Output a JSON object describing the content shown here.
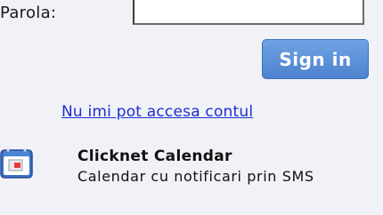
{
  "login": {
    "password_label": "Parola:",
    "password_value": "",
    "signin_label": "Sign in",
    "recover_link": "Nu imi pot accesa contul"
  },
  "promo": {
    "icon": "calendar-icon",
    "title": "Clicknet Calendar",
    "subtitle": "Calendar cu notificari prin SMS"
  },
  "colors": {
    "button": "#5a8fd8",
    "link": "#1d2fd0",
    "background": "#f1f1f8"
  }
}
